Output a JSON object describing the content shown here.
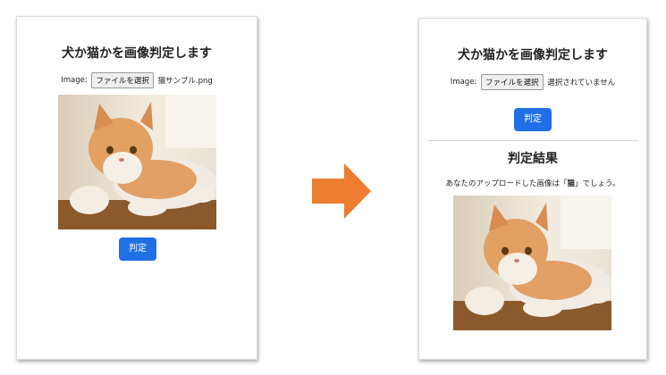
{
  "left_panel": {
    "title": "犬か猫かを画像判定します",
    "file_label": "Image:",
    "file_button": "ファイルを選択",
    "file_name": "猫サンプル.png",
    "submit_label": "判定"
  },
  "right_panel": {
    "title": "犬か猫かを画像判定します",
    "file_label": "Image:",
    "file_button": "ファイルを選択",
    "file_name": "選択されていません",
    "submit_label": "判定",
    "result_heading": "判定結果",
    "result_prefix": "あなたのアップロードした画像は「",
    "result_value": "猫",
    "result_suffix": "」でしょう。"
  },
  "colors": {
    "accent": "#1f6fe5",
    "arrow": "#ed7d31"
  },
  "icons": {
    "arrow": "right-arrow-icon"
  }
}
